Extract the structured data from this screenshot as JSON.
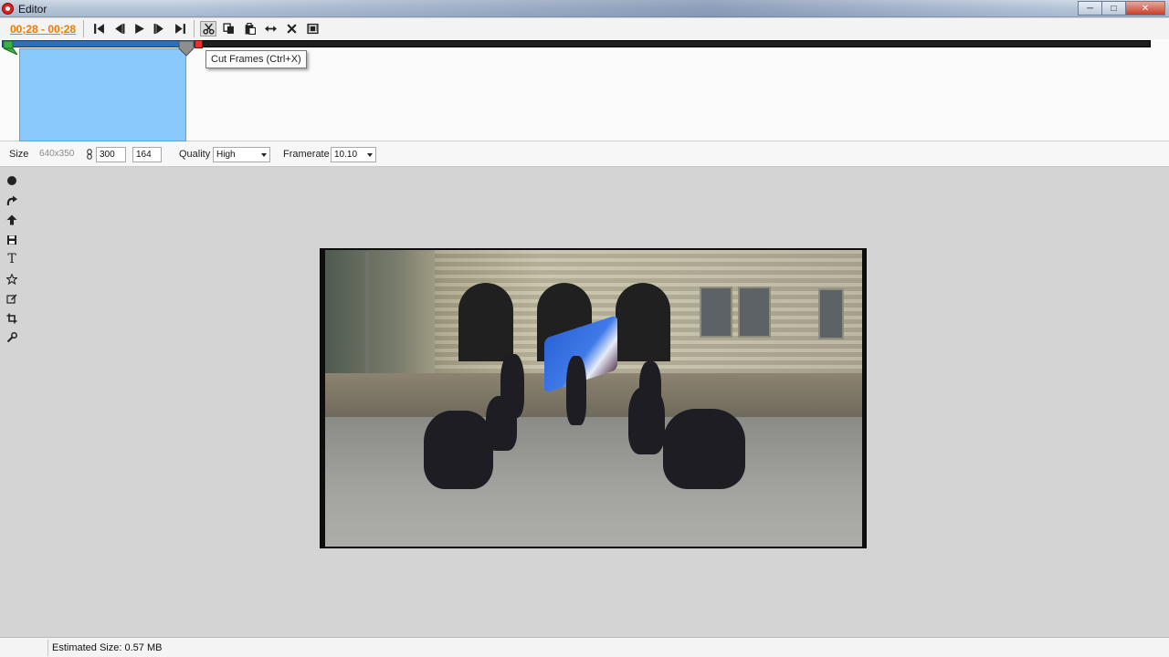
{
  "window": {
    "title": "Editor",
    "controls": {
      "minimize": "─",
      "maximize": "□",
      "close": "✕"
    }
  },
  "toolbar": {
    "time_range": "00;28 - 00;28",
    "buttons": [
      {
        "name": "first-frame",
        "icon": "skip-start-icon"
      },
      {
        "name": "previous-frame",
        "icon": "step-back-icon"
      },
      {
        "name": "play",
        "icon": "play-icon"
      },
      {
        "name": "next-frame",
        "icon": "step-forward-icon"
      },
      {
        "name": "last-frame",
        "icon": "skip-end-icon"
      },
      {
        "name": "cut-frames",
        "icon": "scissors-icon"
      },
      {
        "name": "copy-frames",
        "icon": "copy-icon"
      },
      {
        "name": "paste-frames",
        "icon": "paste-icon"
      },
      {
        "name": "resize",
        "icon": "horizontal-resize-icon"
      },
      {
        "name": "delete-frames",
        "icon": "x-icon"
      },
      {
        "name": "frames",
        "icon": "film-icon"
      }
    ]
  },
  "timeline": {
    "tooltip": "Cut Frames (Ctrl+X)",
    "played_fraction": 0.168,
    "colors": {
      "track": "#1e1e1e",
      "played": "#2e6fb8",
      "selection": "#8ac9fb",
      "end_marker": "#e6332a",
      "start_marker": "#3cb043"
    }
  },
  "properties": {
    "size_label": "Size",
    "original_size": "640x350",
    "width": "300",
    "height": "164",
    "quality_label": "Quality",
    "quality_value": "High",
    "framerate_label": "Framerate",
    "framerate_value": "10.10"
  },
  "side_tools": [
    {
      "name": "record",
      "icon": "circle-icon"
    },
    {
      "name": "redo",
      "icon": "redo-icon"
    },
    {
      "name": "upload",
      "icon": "arrow-up-icon"
    },
    {
      "name": "save",
      "icon": "save-icon"
    },
    {
      "name": "text",
      "icon": "text-icon",
      "glyph": "T"
    },
    {
      "name": "favorite",
      "icon": "star-icon"
    },
    {
      "name": "edit",
      "icon": "edit-icon"
    },
    {
      "name": "crop",
      "icon": "crop-icon"
    },
    {
      "name": "tools",
      "icon": "wrench-icon"
    }
  ],
  "status": {
    "estimated_size": "Estimated Size: 0.57 MB"
  },
  "colors": {
    "accent_time": "#f07a00",
    "canvas_bg": "#d4d4d4"
  }
}
